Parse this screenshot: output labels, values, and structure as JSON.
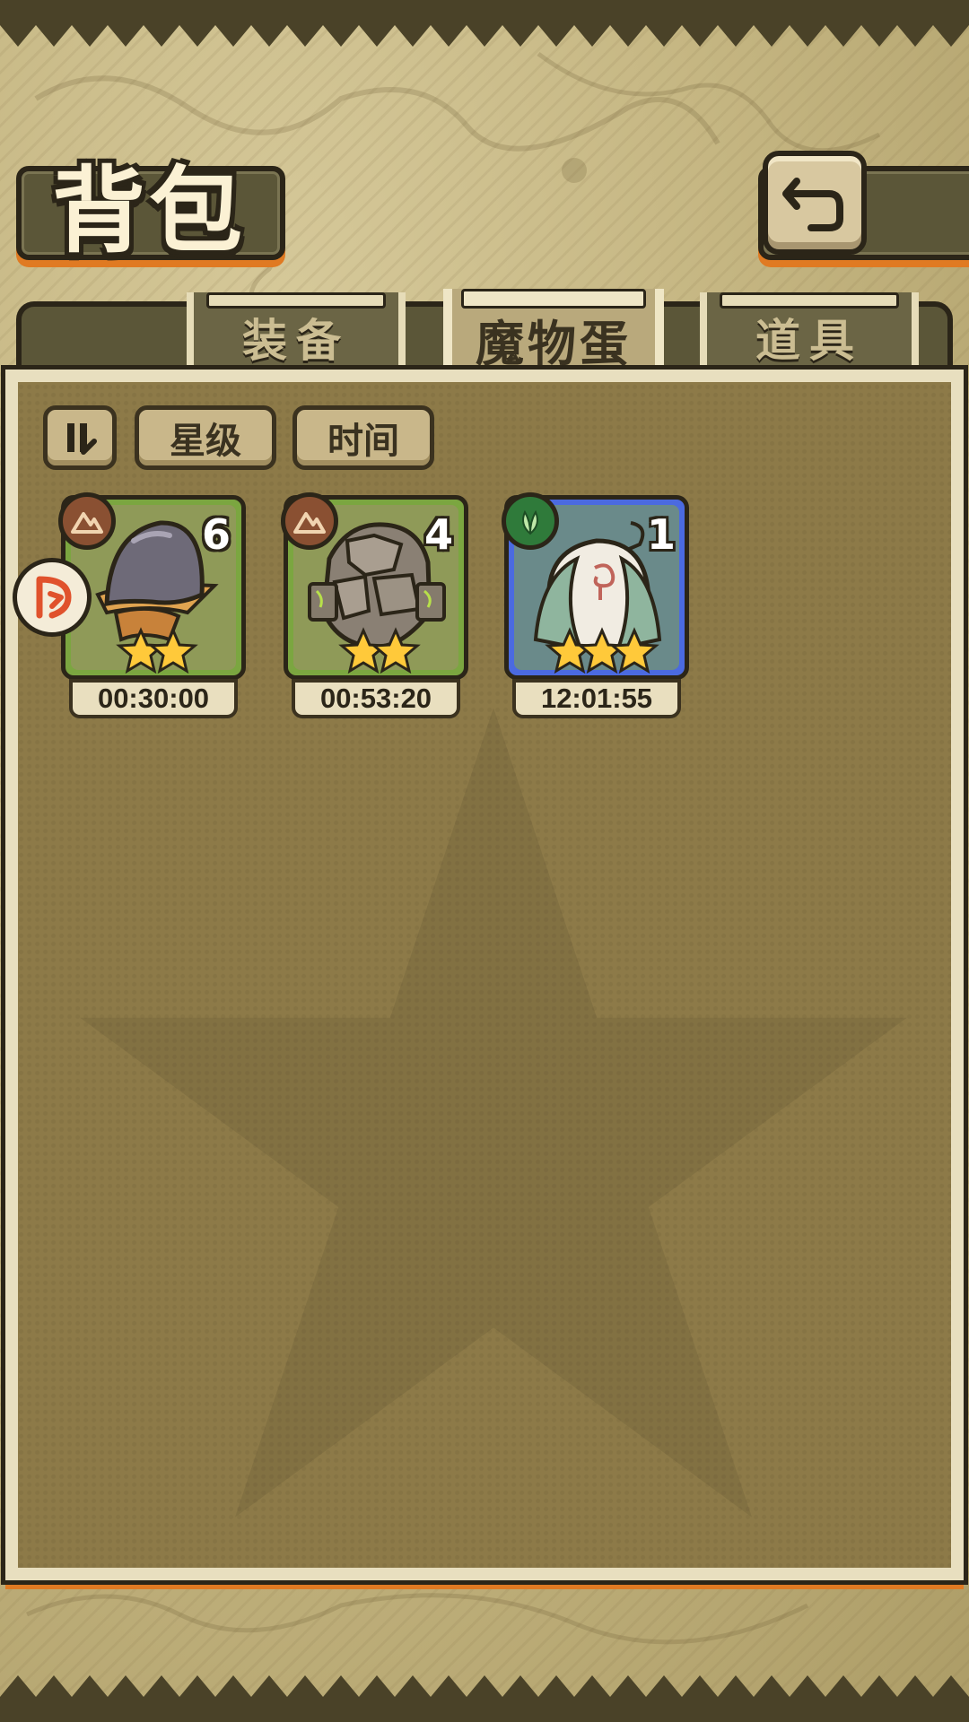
{
  "header": {
    "title": "背包"
  },
  "tabs": [
    {
      "label": "装备",
      "active": false
    },
    {
      "label": "魔物蛋",
      "active": true
    },
    {
      "label": "道具",
      "active": false
    }
  ],
  "sort": {
    "toggle_icon": "sort-order-icon",
    "star_label": "星级",
    "time_label": "时间"
  },
  "eggs": [
    {
      "element": "earth",
      "count": "6",
      "stars": 2,
      "timer": "00:30:00",
      "rarity_color": "#7ba640"
    },
    {
      "element": "earth",
      "count": "4",
      "stars": 2,
      "timer": "00:53:20",
      "rarity_color": "#7ba640"
    },
    {
      "element": "nature",
      "count": "1",
      "stars": 3,
      "timer": "12:01:55",
      "rarity_color": "#4b6ae0"
    }
  ],
  "colors": {
    "accent_orange": "#e07a22",
    "panel_brown": "#8d7a48",
    "frame_cream": "#e8dfbf"
  }
}
